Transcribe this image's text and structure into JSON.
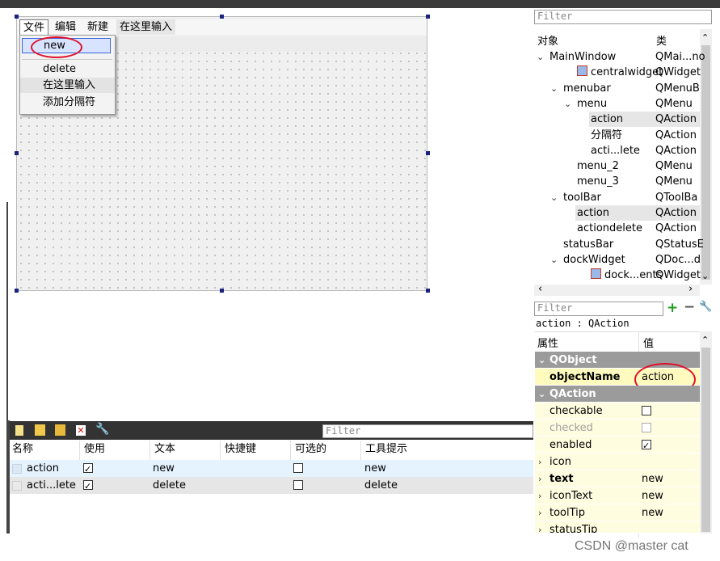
{
  "form": {
    "menubar": [
      "文件",
      "编辑",
      "新建",
      "在这里输入"
    ],
    "dropdown_items": [
      "new",
      "delete",
      "在这里输入",
      "添加分隔符"
    ]
  },
  "object_inspector": {
    "filter_placeholder": "Filter",
    "col_object": "对象",
    "col_class": "类",
    "rows": [
      {
        "name": "MainWindow",
        "cls": "QMai...no"
      },
      {
        "name": "centralwidget",
        "cls": "QWidget"
      },
      {
        "name": "menubar",
        "cls": "QMenuB"
      },
      {
        "name": "menu",
        "cls": "QMenu"
      },
      {
        "name": "action",
        "cls": "QAction"
      },
      {
        "name": "分隔符",
        "cls": "QAction"
      },
      {
        "name": "acti...lete",
        "cls": "QAction"
      },
      {
        "name": "menu_2",
        "cls": "QMenu"
      },
      {
        "name": "menu_3",
        "cls": "QMenu"
      },
      {
        "name": "toolBar",
        "cls": "QToolBa"
      },
      {
        "name": "action",
        "cls": "QAction"
      },
      {
        "name": "actiondelete",
        "cls": "QAction"
      },
      {
        "name": "statusBar",
        "cls": "QStatusE"
      },
      {
        "name": "dockWidget",
        "cls": "QDoc...d"
      },
      {
        "name": "dock...ents",
        "cls": "QWidget"
      }
    ]
  },
  "property_editor": {
    "filter_placeholder": "Filter",
    "object_label": "action : QAction",
    "col_property": "属性",
    "col_value": "值",
    "section_qobject": "QObject",
    "objectName_key": "objectName",
    "objectName_value": "action",
    "section_qaction": "QAction",
    "checkable": "checkable",
    "checked": "checked",
    "enabled": "enabled",
    "icon": "icon",
    "text_key": "text",
    "text_value": "new",
    "iconText_key": "iconText",
    "iconText_value": "new",
    "toolTip_key": "toolTip",
    "toolTip_value": "new",
    "statusTip_key": "statusTip"
  },
  "action_editor": {
    "filter_placeholder": "Filter",
    "headers": [
      "名称",
      "使用",
      "文本",
      "快捷键",
      "可选的",
      "工具提示"
    ],
    "rows": [
      {
        "name": "action",
        "used": true,
        "text": "new",
        "shortcut": "",
        "checkable": false,
        "tooltip": "new"
      },
      {
        "name": "acti...lete",
        "used": true,
        "text": "delete",
        "shortcut": "",
        "checkable": false,
        "tooltip": "delete"
      }
    ]
  },
  "watermark": "CSDN @master cat",
  "colors": {
    "annotation_red": "#e0102a",
    "section_gray": "#9b9b9b",
    "property_yellow": "#fffde0",
    "selection_blue": "#3c64dc"
  }
}
